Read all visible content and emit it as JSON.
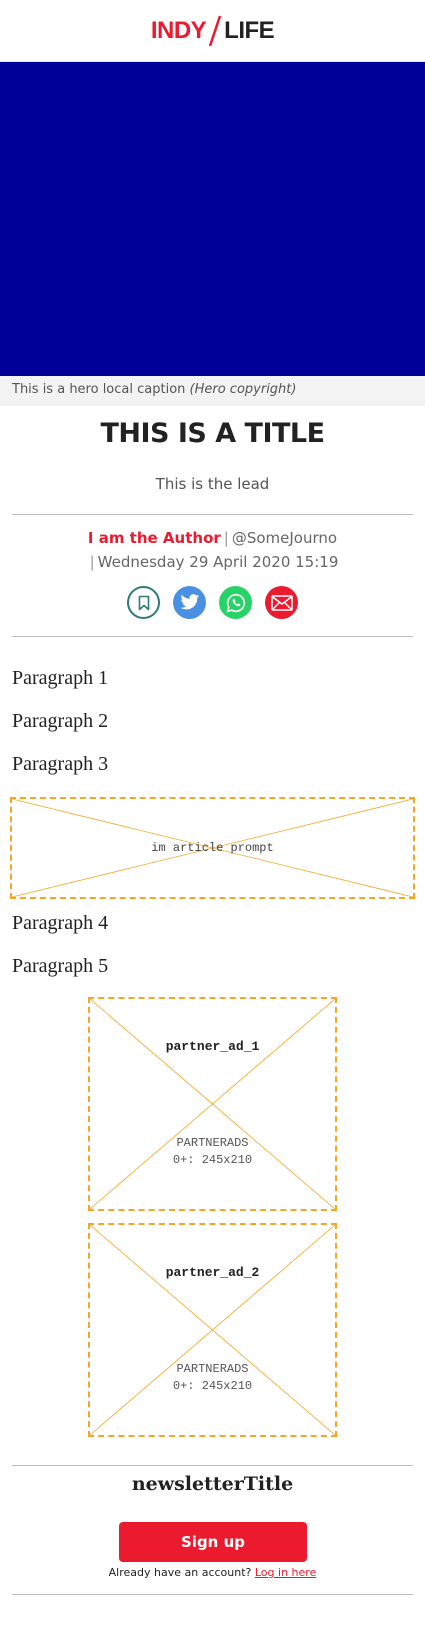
{
  "header": {
    "logo": {
      "left_text": "INDY",
      "right_text": "LIFE"
    }
  },
  "colors": {
    "brand_red": "#ec1a2e",
    "hero_blue": "#000099",
    "placeholder_orange": "#f5a623",
    "twitter_blue": "#4a90e2",
    "whatsapp_green": "#25d366"
  },
  "hero": {
    "caption": "This is a hero local caption",
    "copyright": "(Hero copyright)"
  },
  "article": {
    "title": "THIS IS A TITLE",
    "lead": "This is the lead",
    "author": "I am the Author",
    "twitter_handle": "@SomeJourno",
    "date": "Wednesday 29 April 2020 15:19",
    "share_icons": [
      "bookmark-icon",
      "twitter-icon",
      "whatsapp-icon",
      "email-icon"
    ],
    "paragraphs": [
      "Paragraph 1",
      "Paragraph 2",
      "Paragraph 3",
      "Paragraph 4",
      "Paragraph 5"
    ]
  },
  "placeholders": {
    "article_prompt": "im article prompt",
    "partner_ad_1": {
      "name": "partner_ad_1",
      "line1": "PARTNERADS",
      "line2": "0+: 245x210"
    },
    "partner_ad_2": {
      "name": "partner_ad_2",
      "line1": "PARTNERADS",
      "line2": "0+: 245x210"
    }
  },
  "newsletter": {
    "title": "newsletterTitle",
    "signup_label": "Sign up",
    "account_prompt": "Already have an account?",
    "login_label": "Log in here"
  }
}
